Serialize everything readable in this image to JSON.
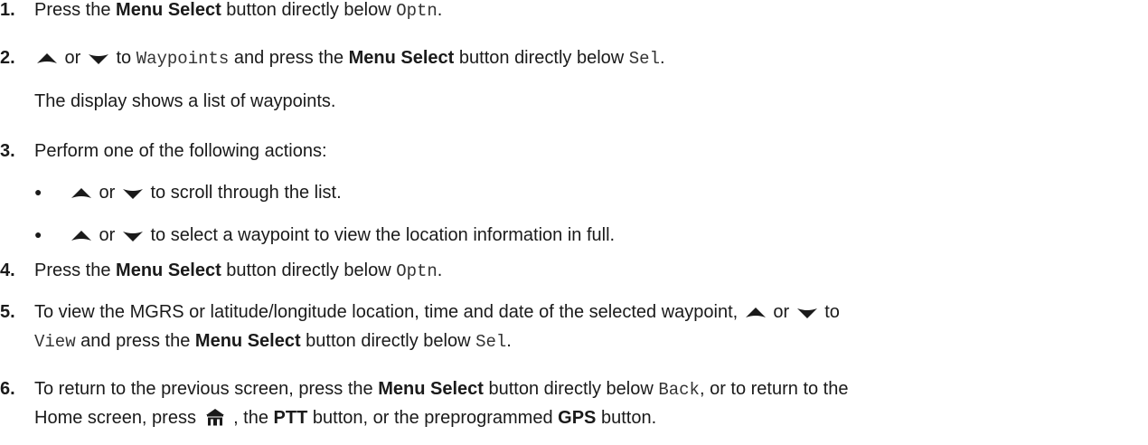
{
  "steps": [
    {
      "num": "1.",
      "a": "Press the ",
      "b": "Menu Select",
      "c": " button directly below ",
      "mono": "Optn",
      "end": "."
    },
    {
      "num": "2.",
      "or": " or ",
      "to": " to ",
      "mono1": "Waypoints",
      "mid": " and press the ",
      "b": "Menu Select",
      "c": " button directly below ",
      "mono2": "Sel",
      "end": "."
    },
    {
      "note": "The display shows a list of waypoints."
    },
    {
      "num": "3.",
      "text": "Perform one of the following actions:"
    },
    {
      "num": "4.",
      "a": "Press the ",
      "b": "Menu Select",
      "c": " button directly below ",
      "mono": "Optn",
      "end": "."
    },
    {
      "num": "5.",
      "line1": "To view the MGRS or latitude/longitude location, time and date of the selected waypoint, ",
      "or": " or ",
      "to": " to",
      "mono1": "View",
      "mid": " and press the ",
      "b": "Menu Select",
      "c": " button directly below ",
      "mono2": "Sel",
      "end": "."
    },
    {
      "num": "6.",
      "line1a": "To return to the previous screen, press the ",
      "b1": "Menu Select",
      "line1b": " button directly below ",
      "mono": "Back",
      "line1c": ", or to return to the",
      "line2a": "Home screen, press ",
      "line2b": " , the ",
      "b2": "PTT",
      "line2c": " button, or the preprogrammed ",
      "b3": "GPS",
      "line2d": " button."
    }
  ],
  "bullets": [
    {
      "bullet": "●",
      "or": " or ",
      "text": " to scroll through the list."
    },
    {
      "bullet": "●",
      "or": " or ",
      "text": " to select a waypoint to view the location information in full."
    }
  ],
  "icons": {
    "up": "up-arrow-icon",
    "down": "down-arrow-icon",
    "home": "home-icon"
  }
}
